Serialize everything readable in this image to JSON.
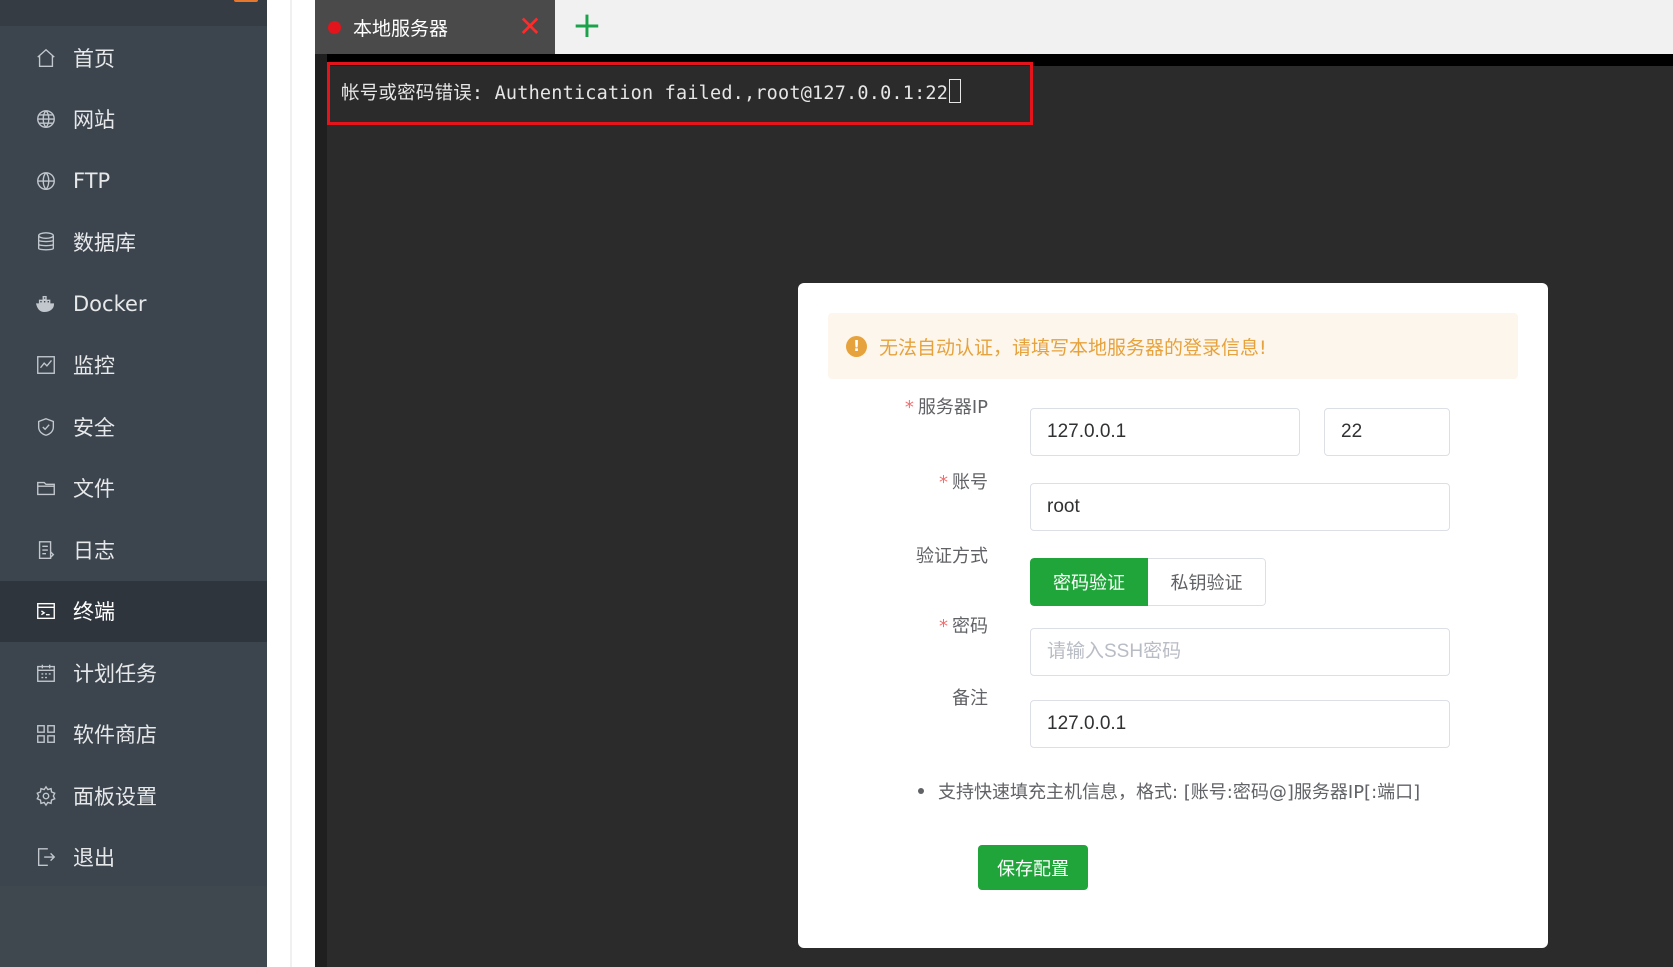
{
  "sidebar": {
    "items": [
      {
        "label": "首页",
        "icon": "home-icon"
      },
      {
        "label": "网站",
        "icon": "globe-icon"
      },
      {
        "label": "FTP",
        "icon": "globe-icon"
      },
      {
        "label": "数据库",
        "icon": "database-icon"
      },
      {
        "label": "Docker",
        "icon": "docker-icon"
      },
      {
        "label": "监控",
        "icon": "monitor-icon"
      },
      {
        "label": "安全",
        "icon": "shield-icon"
      },
      {
        "label": "文件",
        "icon": "folder-icon"
      },
      {
        "label": "日志",
        "icon": "log-icon"
      },
      {
        "label": "终端",
        "icon": "terminal-icon",
        "active": true
      },
      {
        "label": "计划任务",
        "icon": "calendar-icon"
      },
      {
        "label": "软件商店",
        "icon": "apps-icon"
      },
      {
        "label": "面板设置",
        "icon": "gear-icon"
      },
      {
        "label": "退出",
        "icon": "logout-icon"
      }
    ]
  },
  "terminal": {
    "tab_label": "本地服务器",
    "tab_close": "✕",
    "add_tab": "+",
    "output_line": "帐号或密码错误: Authentication failed.,root@127.0.0.1:22"
  },
  "dialog": {
    "alert": "无法自动认证，请填写本地服务器的登录信息!",
    "server_ip_label": "服务器IP",
    "server_ip_value": "127.0.0.1",
    "port_value": "22",
    "account_label": "账号",
    "account_value": "root",
    "auth_label": "验证方式",
    "auth_password": "密码验证",
    "auth_key": "私钥验证",
    "password_label": "密码",
    "password_placeholder": "请输入SSH密码",
    "note_label": "备注",
    "note_value": "127.0.0.1",
    "hint": "支持快速填充主机信息，格式: [账号:密码@]服务器IP[:端口]",
    "save_button": "保存配置",
    "required_mark": "*"
  },
  "colors": {
    "sidebar_bg": "#3c444d",
    "sidebar_active": "#2f353c",
    "accent_green": "#20a53a",
    "error_red": "#e3141b",
    "warning": "#e6a23c"
  }
}
